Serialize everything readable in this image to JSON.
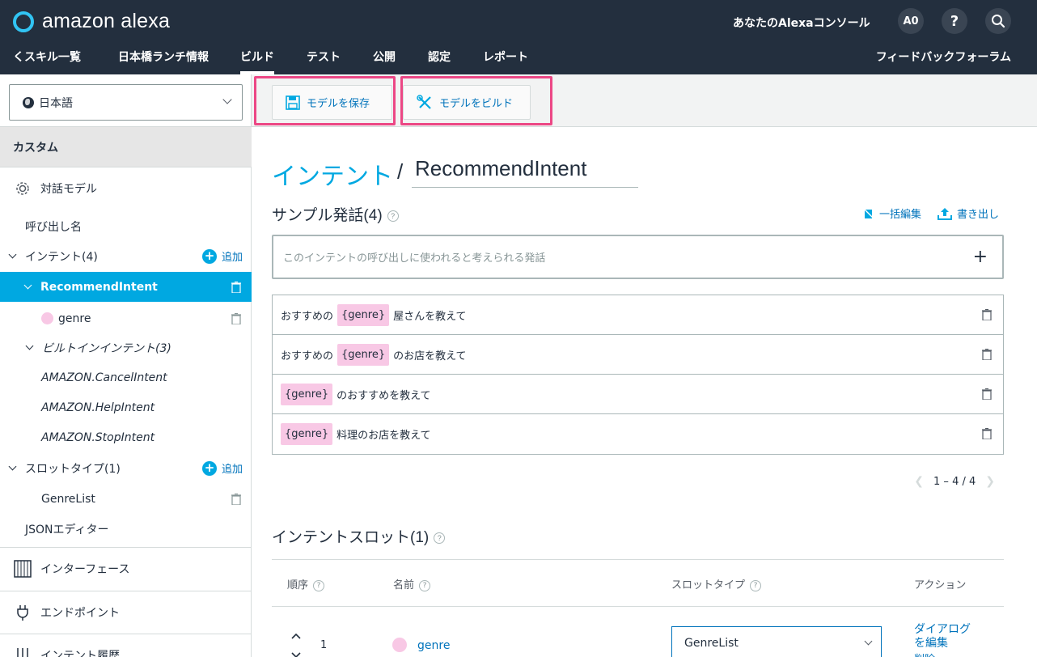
{
  "header": {
    "brand": "amazon alexa",
    "console_label": "あなたのAlexaコンソール",
    "avatar_initials": "A0",
    "help_label": "?",
    "search_icon": "search-icon"
  },
  "nav": {
    "back": "くスキル一覧",
    "skill_name": "日本橋ランチ情報",
    "tabs": [
      "ビルド",
      "テスト",
      "公開",
      "認定",
      "レポート"
    ],
    "active_tab": "ビルド",
    "feedback": "フィードバックフォーラム"
  },
  "sidebar": {
    "language": "日本語",
    "custom_heading": "カスタム",
    "dialog_model": "対話モデル",
    "invocation": "呼び出し名",
    "intents": "インテント(4)",
    "add": "追加",
    "selected_intent": "RecommendIntent",
    "slot_genre": "genre",
    "builtin_intents": "ビルトインインテント(3)",
    "builtin_list": [
      "AMAZON.CancelIntent",
      "AMAZON.HelpIntent",
      "AMAZON.StopIntent"
    ],
    "slot_types": "スロットタイプ(1)",
    "slot_type_item": "GenreList",
    "json_editor": "JSONエディター",
    "interfaces": "インターフェース",
    "endpoint": "エンドポイント",
    "intent_history": "インテント履歴"
  },
  "toolbar": {
    "save_model": "モデルを保存",
    "build_model": "モデルをビルド"
  },
  "main": {
    "breadcrumb_link": "インテント",
    "breadcrumb_sep": "/",
    "intent_name": "RecommendIntent",
    "sample_heading": "サンプル発話(4)",
    "bulk_edit": "一括編集",
    "export": "書き出し",
    "utterance_placeholder": "このインテントの呼び出しに使われると考えられる発話",
    "add_symbol": "+",
    "utterances": [
      {
        "pre": "おすすめの",
        "slot": "{genre}",
        "post": "屋さんを教えて"
      },
      {
        "pre": "おすすめの",
        "slot": "{genre}",
        "post": "のお店を教えて"
      },
      {
        "pre": "",
        "slot": "{genre}",
        "post": "のおすすめを教えて"
      },
      {
        "pre": "",
        "slot": "{genre}",
        "post": "料理のお店を教えて"
      }
    ],
    "pager": "1 – 4 / 4",
    "slot_heading": "インテントスロット(1)",
    "slot_table": {
      "headers": [
        "順序",
        "名前",
        "スロットタイプ",
        "アクション"
      ],
      "row": {
        "order": "1",
        "name": "genre",
        "type": "GenreList",
        "action": "ダイアログを編集",
        "action2": "削除"
      }
    }
  },
  "colors": {
    "header_bg": "#232f3e",
    "accent": "#00a8e1",
    "link": "#0073bb",
    "slot_chip": "#f8c8e5",
    "highlight": "#ec4785"
  }
}
